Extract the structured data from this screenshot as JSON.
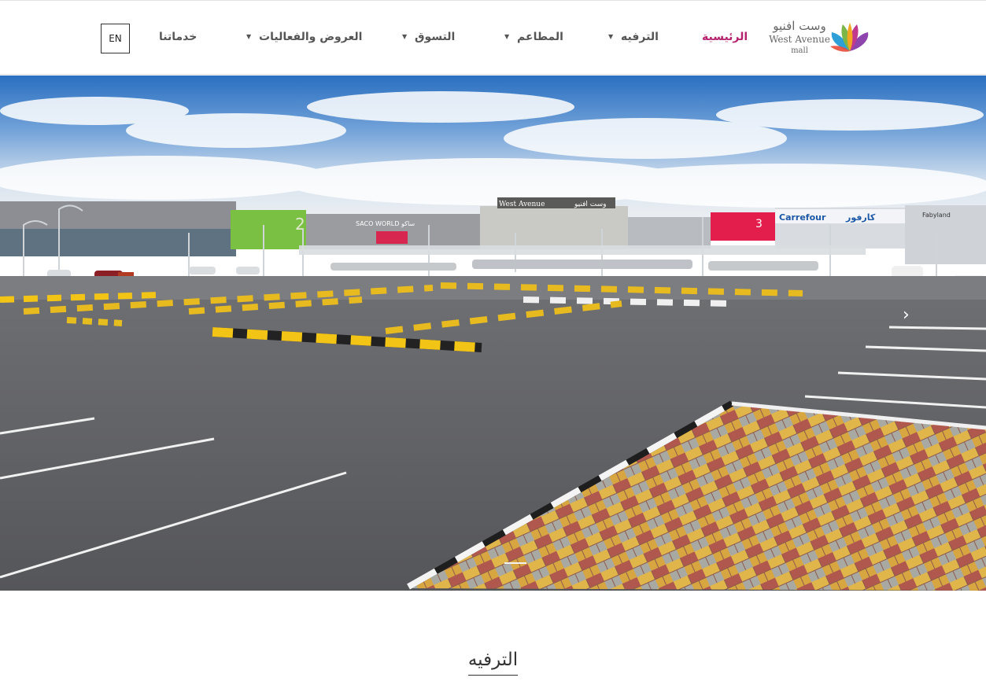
{
  "header": {
    "lang_button": "EN",
    "logo": {
      "arabic": "وست افنيو",
      "english": "West Avenue",
      "sub": "mall",
      "petal_colors": [
        "#e84b3a",
        "#f4a623",
        "#7ab648",
        "#2f9fd8",
        "#8e44ad",
        "#c0398d"
      ]
    },
    "nav": [
      {
        "label": "الرئيسية",
        "active": true,
        "has_dropdown": false
      },
      {
        "label": "الترفيه",
        "active": false,
        "has_dropdown": true
      },
      {
        "label": "المطاعم",
        "active": false,
        "has_dropdown": true
      },
      {
        "label": "التسوق",
        "active": false,
        "has_dropdown": true
      },
      {
        "label": "العروض والفعاليات",
        "active": false,
        "has_dropdown": true
      },
      {
        "label": "خدماتنا",
        "active": false,
        "has_dropdown": false
      }
    ],
    "colors": {
      "active": "#b5236f",
      "nav": "#555555"
    }
  },
  "hero": {
    "image_subject": "mall-parking-lot",
    "building_signs": {
      "center_en": "West Avenue",
      "center_ar": "وست افنيو",
      "saco": "SACO WORLD",
      "saco_ar": "ساكو",
      "carrefour": "Carrefour",
      "carrefour_ar": "كارفور",
      "fabyland": "Fabyland",
      "entrance_2": "2",
      "entrance_3": "3"
    },
    "next_arrow": "chevron-right-icon"
  },
  "section": {
    "title": "الترفيه"
  }
}
